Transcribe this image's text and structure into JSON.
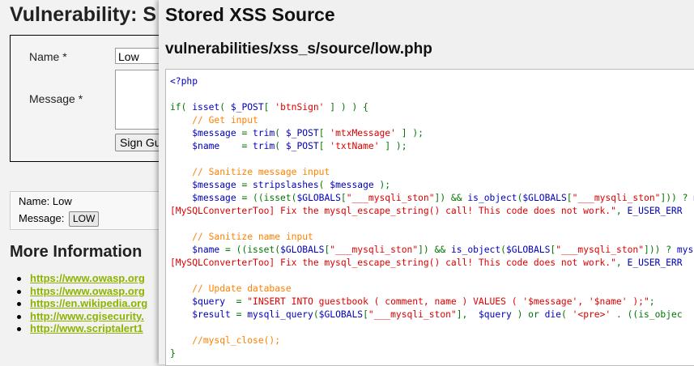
{
  "background": {
    "title": "Vulnerability: S",
    "form": {
      "name_label": "Name *",
      "name_value": "Low",
      "message_label": "Message *",
      "sign_button": "Sign Gu"
    },
    "entry": {
      "name_line": "Name: Low",
      "message_label": "Message:",
      "message_value": "LOW"
    },
    "more_info_title": "More Information",
    "links": [
      "https://www.owasp.org",
      "https://www.owasp.org",
      "https://en.wikipedia.org",
      "http://www.cgisecurity.",
      "http://www.scriptalert1"
    ]
  },
  "modal": {
    "title": "Stored XSS Source",
    "path": "vulnerabilities/xss_s/source/low.php"
  },
  "code": [
    [
      [
        "default",
        "<?php"
      ]
    ],
    [],
    [
      [
        "keyword",
        "if( "
      ],
      [
        "default",
        "isset"
      ],
      [
        "keyword",
        "( "
      ],
      [
        "default",
        "$_POST"
      ],
      [
        "keyword",
        "[ "
      ],
      [
        "string",
        "'btnSign'"
      ],
      [
        "keyword",
        " ] ) ) {"
      ]
    ],
    [
      [
        "keyword",
        "    "
      ],
      [
        "comment",
        "// Get input"
      ]
    ],
    [
      [
        "keyword",
        "    "
      ],
      [
        "default",
        "$message"
      ],
      [
        "keyword",
        " = "
      ],
      [
        "default",
        "trim"
      ],
      [
        "keyword",
        "( "
      ],
      [
        "default",
        "$_POST"
      ],
      [
        "keyword",
        "[ "
      ],
      [
        "string",
        "'mtxMessage'"
      ],
      [
        "keyword",
        " ] );"
      ]
    ],
    [
      [
        "keyword",
        "    "
      ],
      [
        "default",
        "$name"
      ],
      [
        "keyword",
        "    = "
      ],
      [
        "default",
        "trim"
      ],
      [
        "keyword",
        "( "
      ],
      [
        "default",
        "$_POST"
      ],
      [
        "keyword",
        "[ "
      ],
      [
        "string",
        "'txtName'"
      ],
      [
        "keyword",
        " ] );"
      ]
    ],
    [],
    [
      [
        "keyword",
        "    "
      ],
      [
        "comment",
        "// Sanitize message input"
      ]
    ],
    [
      [
        "keyword",
        "    "
      ],
      [
        "default",
        "$message"
      ],
      [
        "keyword",
        " = "
      ],
      [
        "default",
        "stripslashes"
      ],
      [
        "keyword",
        "( "
      ],
      [
        "default",
        "$message"
      ],
      [
        "keyword",
        " );"
      ]
    ],
    [
      [
        "keyword",
        "    "
      ],
      [
        "default",
        "$message"
      ],
      [
        "keyword",
        " = ((isset("
      ],
      [
        "default",
        "$GLOBALS"
      ],
      [
        "keyword",
        "["
      ],
      [
        "string",
        "\"___mysqli_ston\""
      ],
      [
        "keyword",
        "]) && "
      ],
      [
        "default",
        "is_object"
      ],
      [
        "keyword",
        "("
      ],
      [
        "default",
        "$GLOBALS"
      ],
      [
        "keyword",
        "["
      ],
      [
        "string",
        "\"___mysqli_ston\""
      ],
      [
        "keyword",
        "])) ? "
      ],
      [
        "default",
        "m"
      ]
    ],
    [
      [
        "string",
        "[MySQLConverterToo] Fix the mysql_escape_string() call! This code does not work.\""
      ],
      [
        "keyword",
        ", "
      ],
      [
        "default",
        "E_USER_ERR"
      ]
    ],
    [],
    [
      [
        "keyword",
        "    "
      ],
      [
        "comment",
        "// Sanitize name input"
      ]
    ],
    [
      [
        "keyword",
        "    "
      ],
      [
        "default",
        "$name"
      ],
      [
        "keyword",
        " = ((isset("
      ],
      [
        "default",
        "$GLOBALS"
      ],
      [
        "keyword",
        "["
      ],
      [
        "string",
        "\"___mysqli_ston\""
      ],
      [
        "keyword",
        "]) && "
      ],
      [
        "default",
        "is_object"
      ],
      [
        "keyword",
        "("
      ],
      [
        "default",
        "$GLOBALS"
      ],
      [
        "keyword",
        "["
      ],
      [
        "string",
        "\"___mysqli_ston\""
      ],
      [
        "keyword",
        "])) ? "
      ],
      [
        "default",
        "mys"
      ]
    ],
    [
      [
        "string",
        "[MySQLConverterToo] Fix the mysql_escape_string() call! This code does not work.\""
      ],
      [
        "keyword",
        ", "
      ],
      [
        "default",
        "E_USER_ERR"
      ]
    ],
    [],
    [
      [
        "keyword",
        "    "
      ],
      [
        "comment",
        "// Update database"
      ]
    ],
    [
      [
        "keyword",
        "    "
      ],
      [
        "default",
        "$query"
      ],
      [
        "keyword",
        "  = "
      ],
      [
        "string",
        "\"INSERT INTO guestbook ( comment, name ) VALUES ( '$message', '$name' );\""
      ],
      [
        "keyword",
        ";"
      ]
    ],
    [
      [
        "keyword",
        "    "
      ],
      [
        "default",
        "$result"
      ],
      [
        "keyword",
        " = "
      ],
      [
        "default",
        "mysqli_query"
      ],
      [
        "keyword",
        "("
      ],
      [
        "default",
        "$GLOBALS"
      ],
      [
        "keyword",
        "["
      ],
      [
        "string",
        "\"___mysqli_ston\""
      ],
      [
        "keyword",
        "],  "
      ],
      [
        "default",
        "$query"
      ],
      [
        "keyword",
        " ) or "
      ],
      [
        "default",
        "die"
      ],
      [
        "keyword",
        "( "
      ],
      [
        "string",
        "'<pre>'"
      ],
      [
        "keyword",
        " . ((is_objec"
      ]
    ],
    [],
    [
      [
        "keyword",
        "    "
      ],
      [
        "comment",
        "//mysql_close();"
      ]
    ],
    [
      [
        "keyword",
        "}"
      ]
    ]
  ]
}
